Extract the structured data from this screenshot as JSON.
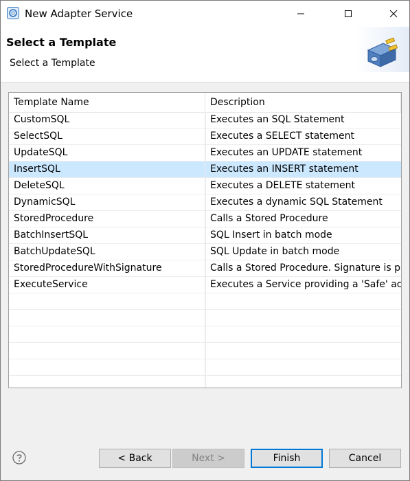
{
  "window": {
    "title": "New Adapter Service"
  },
  "header": {
    "title": "Select a Template",
    "subtitle": "Select a Template"
  },
  "table": {
    "columns": [
      "Template Name",
      "Description"
    ],
    "rows": [
      {
        "name": "CustomSQL",
        "description": "Executes an SQL Statement"
      },
      {
        "name": "SelectSQL",
        "description": "Executes a SELECT statement"
      },
      {
        "name": "UpdateSQL",
        "description": "Executes an UPDATE statement"
      },
      {
        "name": "InsertSQL",
        "description": "Executes an INSERT statement"
      },
      {
        "name": "DeleteSQL",
        "description": "Executes a DELETE statement"
      },
      {
        "name": "DynamicSQL",
        "description": "Executes a dynamic SQL Statement"
      },
      {
        "name": "StoredProcedure",
        "description": "Calls a Stored Procedure"
      },
      {
        "name": "BatchInsertSQL",
        "description": "SQL Insert in batch mode"
      },
      {
        "name": "BatchUpdateSQL",
        "description": "SQL Update in batch mode"
      },
      {
        "name": "StoredProcedureWithSignature",
        "description": "Calls a Stored Procedure. Signature is pr"
      },
      {
        "name": "ExecuteService",
        "description": "Executes a Service providing a 'Safe' acc"
      }
    ],
    "selected_index": 3,
    "empty_rows": 6
  },
  "footer": {
    "back_label": "< Back",
    "next_label": "Next >",
    "finish_label": "Finish",
    "cancel_label": "Cancel"
  },
  "colors": {
    "selection": "#cce8ff",
    "default_button_border": "#0078d7"
  },
  "icons": {
    "app": "app-icon",
    "help": "help-icon",
    "wizard_graphic": "adapter-plug-graphic"
  }
}
